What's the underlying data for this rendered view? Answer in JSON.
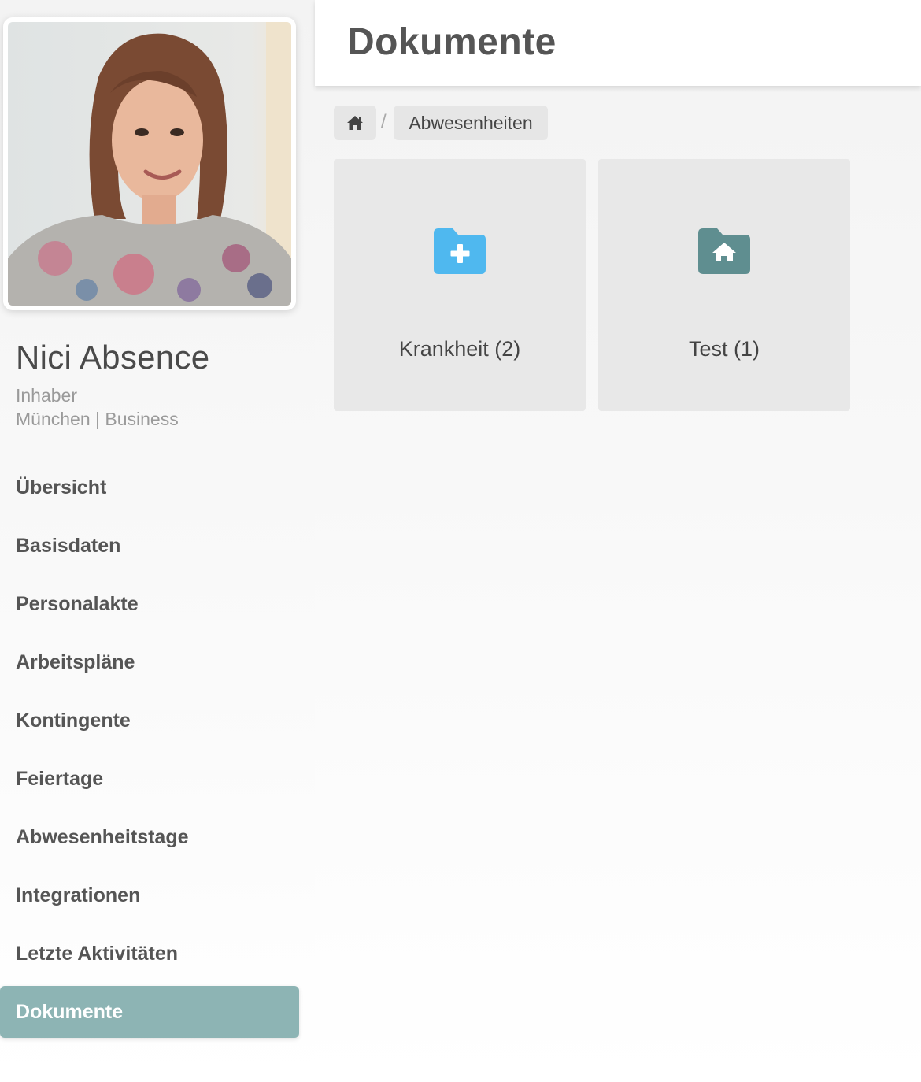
{
  "profile": {
    "name": "Nici Absence",
    "role": "Inhaber",
    "location": "München | Business"
  },
  "nav": {
    "items": [
      {
        "label": "Übersicht"
      },
      {
        "label": "Basisdaten"
      },
      {
        "label": "Personalakte"
      },
      {
        "label": "Arbeitspläne"
      },
      {
        "label": "Kontingente"
      },
      {
        "label": "Feiertage"
      },
      {
        "label": "Abwesenheitstage"
      },
      {
        "label": "Integrationen"
      },
      {
        "label": "Letzte Aktivitäten"
      },
      {
        "label": "Dokumente",
        "active": true
      }
    ]
  },
  "header": {
    "title": "Dokumente"
  },
  "breadcrumb": {
    "home_icon": "home-icon",
    "separator": "/",
    "current": "Abwesenheiten"
  },
  "folders": [
    {
      "label": "Krankheit (2)",
      "icon": "folder-plus-icon",
      "color": "#4fb8ef"
    },
    {
      "label": "Test (1)",
      "icon": "folder-home-icon",
      "color": "#5f8e90"
    }
  ],
  "colors": {
    "accent": "#8db4b4",
    "card": "#e8e8e8"
  }
}
